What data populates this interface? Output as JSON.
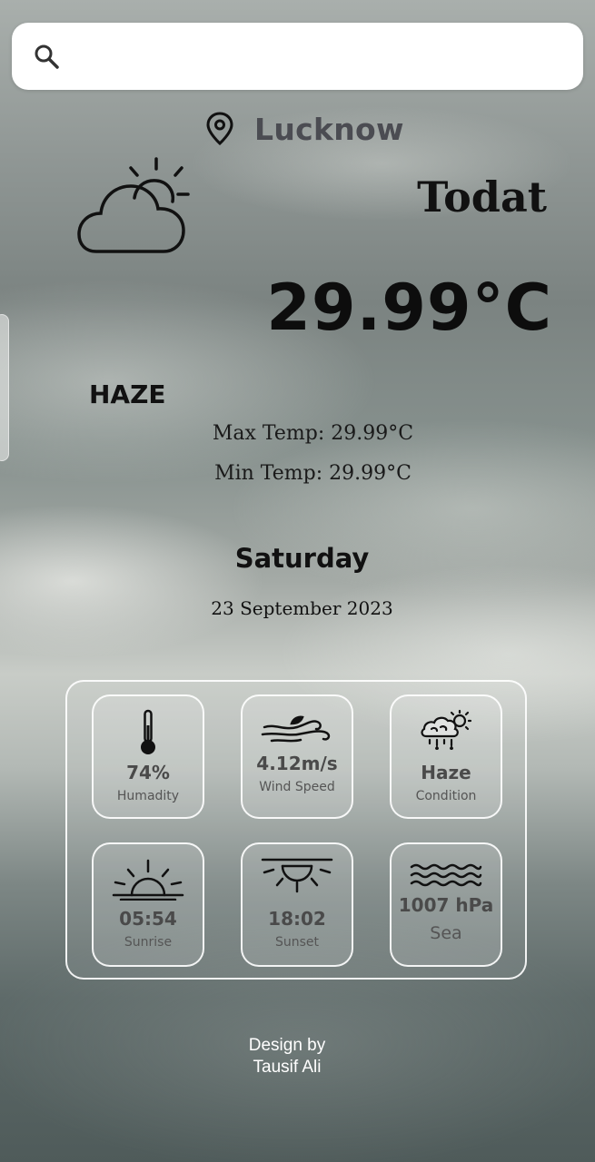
{
  "search": {
    "placeholder": "",
    "value": ""
  },
  "location": {
    "city": "Lucknow"
  },
  "today": {
    "day_label": "Todat",
    "temperature": "29.99°C",
    "condition": "HAZE",
    "max_temp": "Max Temp: 29.99°C",
    "min_temp": "Min Temp: 29.99°C",
    "weekday": "Saturday",
    "date": "23 September 2023"
  },
  "stats": {
    "humidity": {
      "value": "74%",
      "label": "Humadity"
    },
    "wind": {
      "value": "4.12m/s",
      "label": "Wind Speed"
    },
    "condition": {
      "value": "Haze",
      "label": "Condition"
    },
    "sunrise": {
      "value": "05:54",
      "label": "Sunrise"
    },
    "sunset": {
      "value": "18:02",
      "label": "Sunset"
    },
    "sea": {
      "value": "1007 hPa",
      "label": "Sea"
    }
  },
  "footer": {
    "line1": "Design by",
    "line2": "Tausif Ali"
  },
  "icons": {
    "search": "search-icon",
    "location": "location-pin-icon",
    "weather": "partly-cloudy-icon",
    "humidity": "thermometer-icon",
    "wind": "wind-icon",
    "condition": "cloud-rain-sun-icon",
    "sunrise": "sunrise-icon",
    "sunset": "sunset-icon",
    "sea": "waves-icon"
  }
}
